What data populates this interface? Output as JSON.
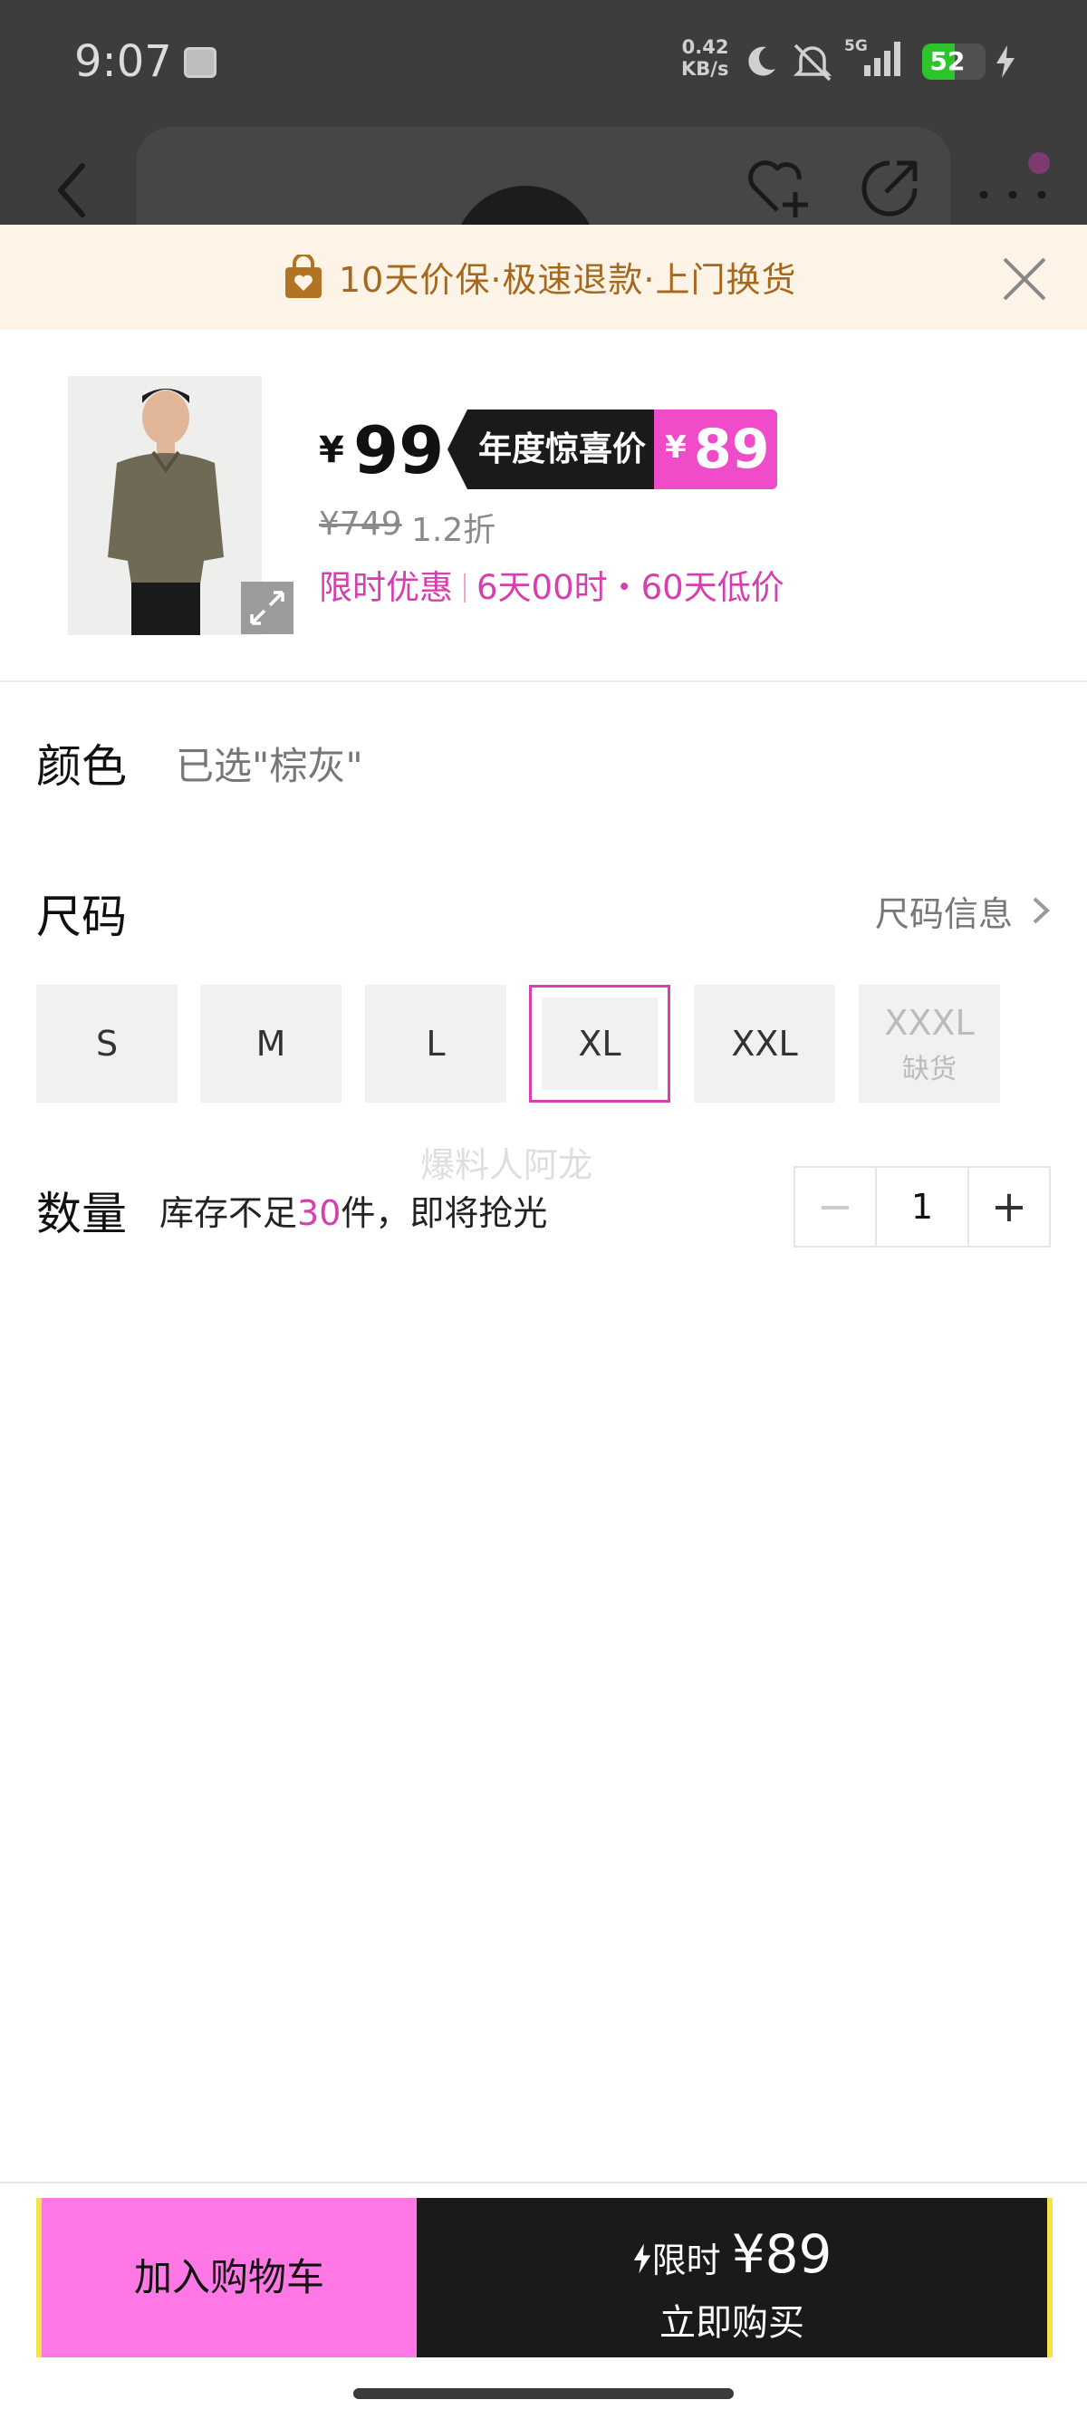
{
  "status_bar": {
    "time": "9:07",
    "net_speed_value": "0.42",
    "net_speed_unit": "KB/s",
    "network": "5G",
    "battery": "52",
    "battery_level": 0.52,
    "icons": [
      "sim-card-icon",
      "moon-icon",
      "bell-muted-icon",
      "signal-icon",
      "battery-icon",
      "charging-bolt-icon"
    ]
  },
  "top_bar": {
    "icons": [
      "back-arrow-icon",
      "heart-plus-icon",
      "share-icon",
      "more-icon"
    ]
  },
  "banner": {
    "text": "10天价保·极速退款·上门换货",
    "icons": [
      "shopping-bag-icon",
      "close-icon"
    ]
  },
  "product": {
    "currency": "¥",
    "price": "99",
    "tag_label": "年度惊喜价",
    "tag_price": "89",
    "original_price": "¥749",
    "discount": "1.2折",
    "promo_label": "限时优惠",
    "promo_detail": "6天00时・60天低价",
    "colors": {
      "accent": "#d63fae",
      "tag_pink": "#f04bc8",
      "banner_text": "#a5681c"
    }
  },
  "color_section": {
    "label": "颜色",
    "value": "已选\"棕灰\""
  },
  "size_section": {
    "label": "尺码",
    "info_link": "尺码信息",
    "sizes": [
      {
        "label": "S",
        "state": "normal"
      },
      {
        "label": "M",
        "state": "normal"
      },
      {
        "label": "L",
        "state": "normal"
      },
      {
        "label": "XL",
        "state": "selected"
      },
      {
        "label": "XXL",
        "state": "normal"
      },
      {
        "label": "XXXL",
        "state": "disabled",
        "note": "缺货"
      }
    ]
  },
  "watermark": "爆料人阿龙",
  "quantity_section": {
    "label": "数量",
    "stock_prefix": "库存不足",
    "stock_count": "30",
    "stock_suffix": "件，即将抢光",
    "minus": "−",
    "value": "1",
    "plus": "+"
  },
  "bottom_bar": {
    "cart_label": "加入购物车",
    "buy_flash": "限时",
    "buy_price": "¥89",
    "buy_label": "立即购买"
  }
}
